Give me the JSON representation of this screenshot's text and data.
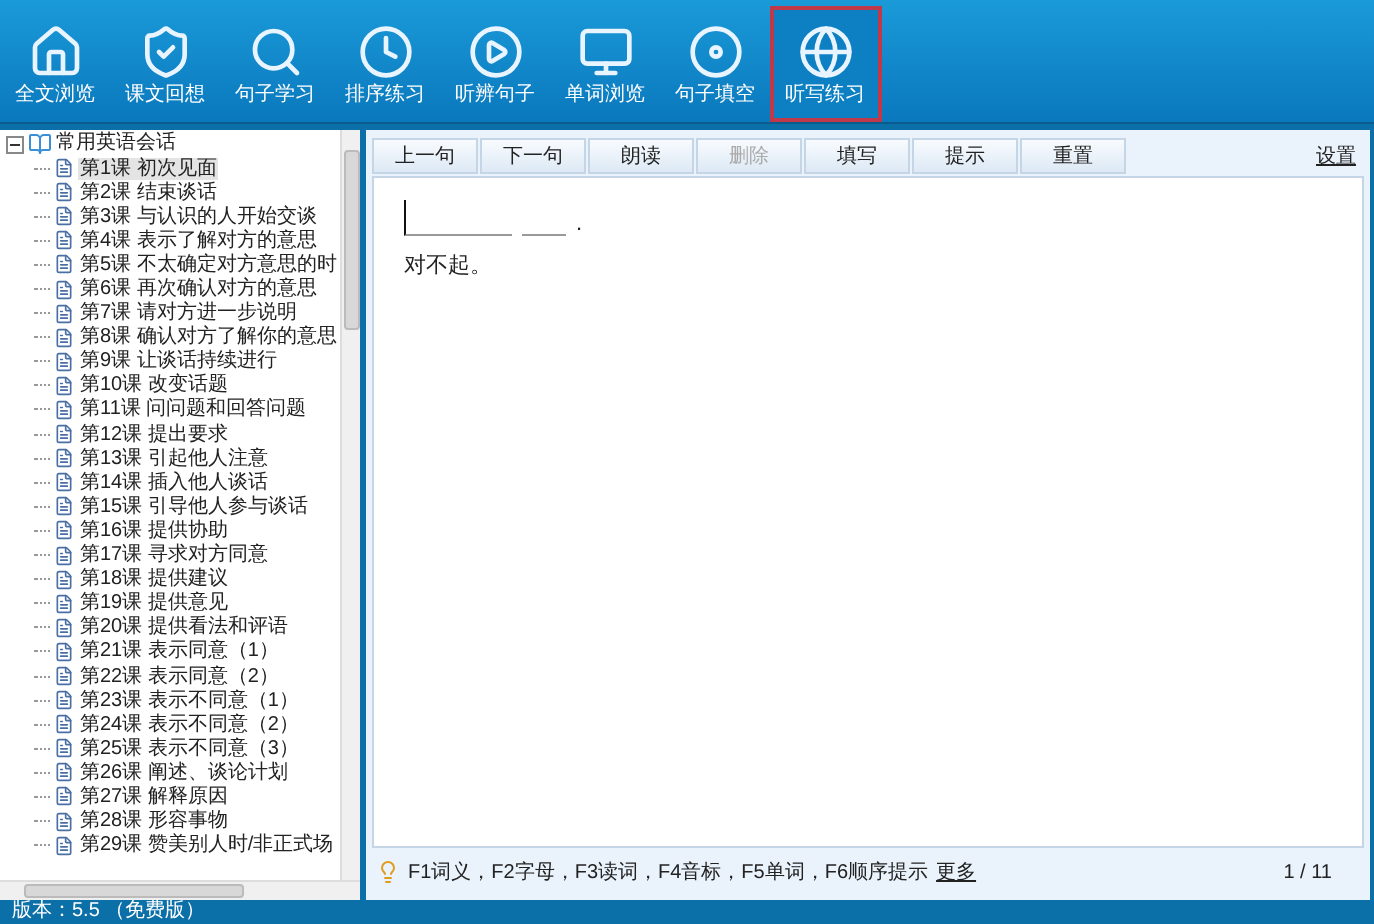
{
  "toolbar": [
    {
      "label": "全文浏览",
      "selected": false
    },
    {
      "label": "课文回想",
      "selected": false
    },
    {
      "label": "句子学习",
      "selected": false
    },
    {
      "label": "排序练习",
      "selected": false
    },
    {
      "label": "听辨句子",
      "selected": false
    },
    {
      "label": "单词浏览",
      "selected": false
    },
    {
      "label": "句子填空",
      "selected": false
    },
    {
      "label": "听写练习",
      "selected": true
    }
  ],
  "tree": {
    "label": "常用英语会话",
    "expanded": true,
    "children": [
      {
        "label": "第1课 初次见面",
        "selected": true
      },
      {
        "label": "第2课 结束谈话",
        "selected": false
      },
      {
        "label": "第3课 与认识的人开始交谈",
        "selected": false
      },
      {
        "label": "第4课 表示了解对方的意思",
        "selected": false
      },
      {
        "label": "第5课 不太确定对方意思的时",
        "selected": false
      },
      {
        "label": "第6课 再次确认对方的意思",
        "selected": false
      },
      {
        "label": "第7课 请对方进一步说明",
        "selected": false
      },
      {
        "label": "第8课 确认对方了解你的意思",
        "selected": false
      },
      {
        "label": "第9课 让谈话持续进行",
        "selected": false
      },
      {
        "label": "第10课 改变话题",
        "selected": false
      },
      {
        "label": "第11课 问问题和回答问题",
        "selected": false
      },
      {
        "label": "第12课 提出要求",
        "selected": false
      },
      {
        "label": "第13课 引起他人注意",
        "selected": false
      },
      {
        "label": "第14课 插入他人谈话",
        "selected": false
      },
      {
        "label": "第15课 引导他人参与谈话",
        "selected": false
      },
      {
        "label": "第16课 提供协助",
        "selected": false
      },
      {
        "label": "第17课 寻求对方同意",
        "selected": false
      },
      {
        "label": "第18课 提供建议",
        "selected": false
      },
      {
        "label": "第19课 提供意见",
        "selected": false
      },
      {
        "label": "第20课 提供看法和评语",
        "selected": false
      },
      {
        "label": "第21课 表示同意（1）",
        "selected": false
      },
      {
        "label": "第22课 表示同意（2）",
        "selected": false
      },
      {
        "label": "第23课 表示不同意（1）",
        "selected": false
      },
      {
        "label": "第24课 表示不同意（2）",
        "selected": false
      },
      {
        "label": "第25课 表示不同意（3）",
        "selected": false
      },
      {
        "label": "第26课 阐述、谈论计划",
        "selected": false
      },
      {
        "label": "第27课 解释原因",
        "selected": false
      },
      {
        "label": "第28课 形容事物",
        "selected": false
      },
      {
        "label": "第29课 赞美别人时/非正式场",
        "selected": false
      }
    ]
  },
  "buttons": [
    {
      "label": "上一句",
      "disabled": false
    },
    {
      "label": "下一句",
      "disabled": false
    },
    {
      "label": "朗读",
      "disabled": false
    },
    {
      "label": "删除",
      "disabled": true
    },
    {
      "label": "填写",
      "disabled": false
    },
    {
      "label": "提示",
      "disabled": false
    },
    {
      "label": "重置",
      "disabled": false
    }
  ],
  "settings_link": "设置",
  "exercise": {
    "blanks": [
      {
        "active": true
      },
      {
        "active": false
      }
    ],
    "punctuation": ".",
    "translation": "对不起。"
  },
  "footer": {
    "hint": "F1词义，F2字母，F3读词，F4音标，F5单词，F6顺序提示",
    "more_link": "更多",
    "page": "1 / 11"
  },
  "status_bar": "版本：5.5 （免费版）"
}
